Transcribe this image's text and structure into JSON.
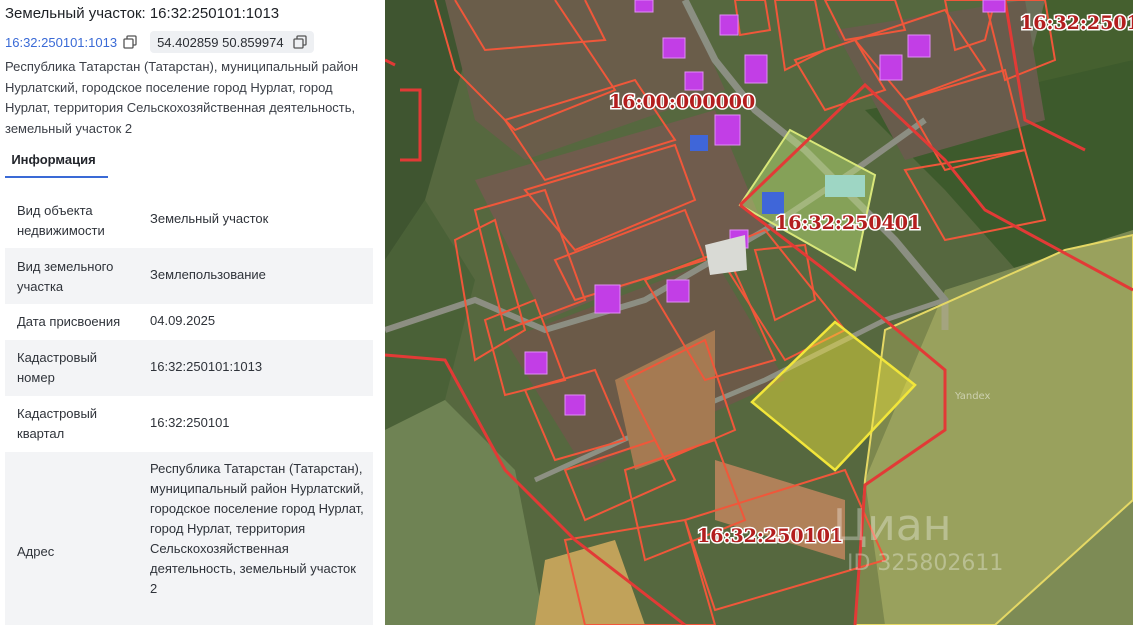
{
  "header": {
    "title": "Земельный участок: 16:32:250101:1013",
    "cadastral_link": "16:32:250101:1013",
    "coordinates": "54.402859 50.859974"
  },
  "address_short": "Республика Татарстан (Татарстан), муниципальный район Нурлатский, городское поселение город Нурлат, город Нурлат, территория Сельскохозяйственная деятельность, земельный участок 2",
  "tabs": [
    {
      "label": "Информация",
      "active": true
    }
  ],
  "info": {
    "rows": [
      {
        "key": "Вид объекта недвижимости",
        "value": "Земельный участок"
      },
      {
        "key": "Вид земельного участка",
        "value": "Землепользование"
      },
      {
        "key": "Дата присвоения",
        "value": "04.09.2025"
      },
      {
        "key": "Кадастровый номер",
        "value": "16:32:250101:1013"
      },
      {
        "key": "Кадастровый квартал",
        "value": "16:32:250101"
      },
      {
        "key": "Адрес",
        "value": "Республика Татарстан (Татарстан), муниципальный район Нурлатский, городское поселение город Нурлат, город Нурлат, территория Сельскохозяйственная деятельность, земельный участок 2"
      }
    ]
  },
  "map": {
    "labels": {
      "quarter_top_right": "16:32:2501",
      "district": "16:00:000000",
      "quarter_center": "16:32:250401",
      "quarter_bottom": "16:32:250101"
    },
    "watermark_provider": "Yandex",
    "watermark_brand": "Циан",
    "watermark_id": "ID 325802611"
  },
  "colors": {
    "accent_blue": "#3a6ad6",
    "boundary_red": "#e03a35",
    "parcel_orange": "#f05a3a",
    "selected_yellow": "#f2e63a",
    "building_magenta": "#c23ee6"
  }
}
